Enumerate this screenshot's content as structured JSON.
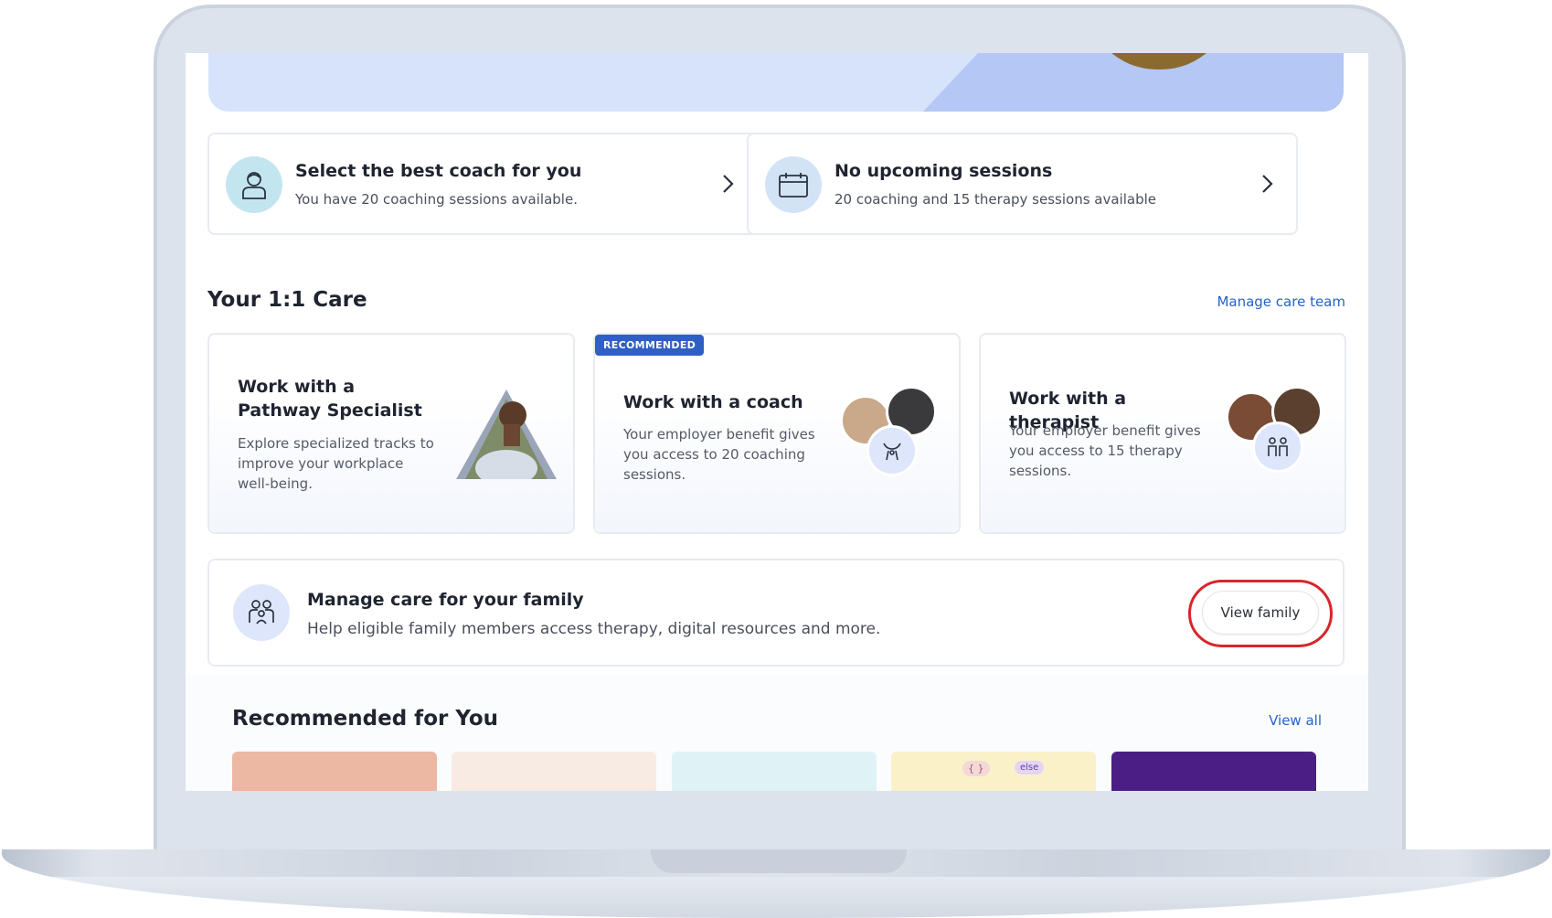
{
  "top_cards": [
    {
      "title": "Select the best coach for you",
      "subtitle": "You have 20 coaching sessions available.",
      "icon": "user-icon"
    },
    {
      "title": "No upcoming sessions",
      "subtitle": "20 coaching and 15 therapy sessions available",
      "icon": "calendar-icon"
    }
  ],
  "care": {
    "heading": "Your 1:1 Care",
    "manage_link": "Manage care team",
    "cards": [
      {
        "title": "Work with a Pathway Specialist",
        "subtitle": "Explore specialized tracks to improve your workplace well-being."
      },
      {
        "badge": "RECOMMENDED",
        "title": "Work with a coach",
        "subtitle": "Your employer benefit gives you access to 20 coaching sessions."
      },
      {
        "title": "Work with a therapist",
        "subtitle": "Your employer benefit gives you access to 15 therapy sessions."
      }
    ]
  },
  "family": {
    "title": "Manage care for your family",
    "subtitle": "Help eligible family members access therapy, digital resources and more.",
    "button": "View family"
  },
  "recommended": {
    "heading": "Recommended for You",
    "view_all": "View all",
    "tile_colors": [
      "#ecb7a3",
      "#f8ebe3",
      "#dff3f6",
      "#fbf1c9",
      "#4b1e86"
    ],
    "tile_labels": [
      "{ }",
      "else"
    ]
  },
  "colors": {
    "accent": "#2563c9",
    "badge": "#2f5fc4",
    "highlight_ring": "#d8262a"
  }
}
